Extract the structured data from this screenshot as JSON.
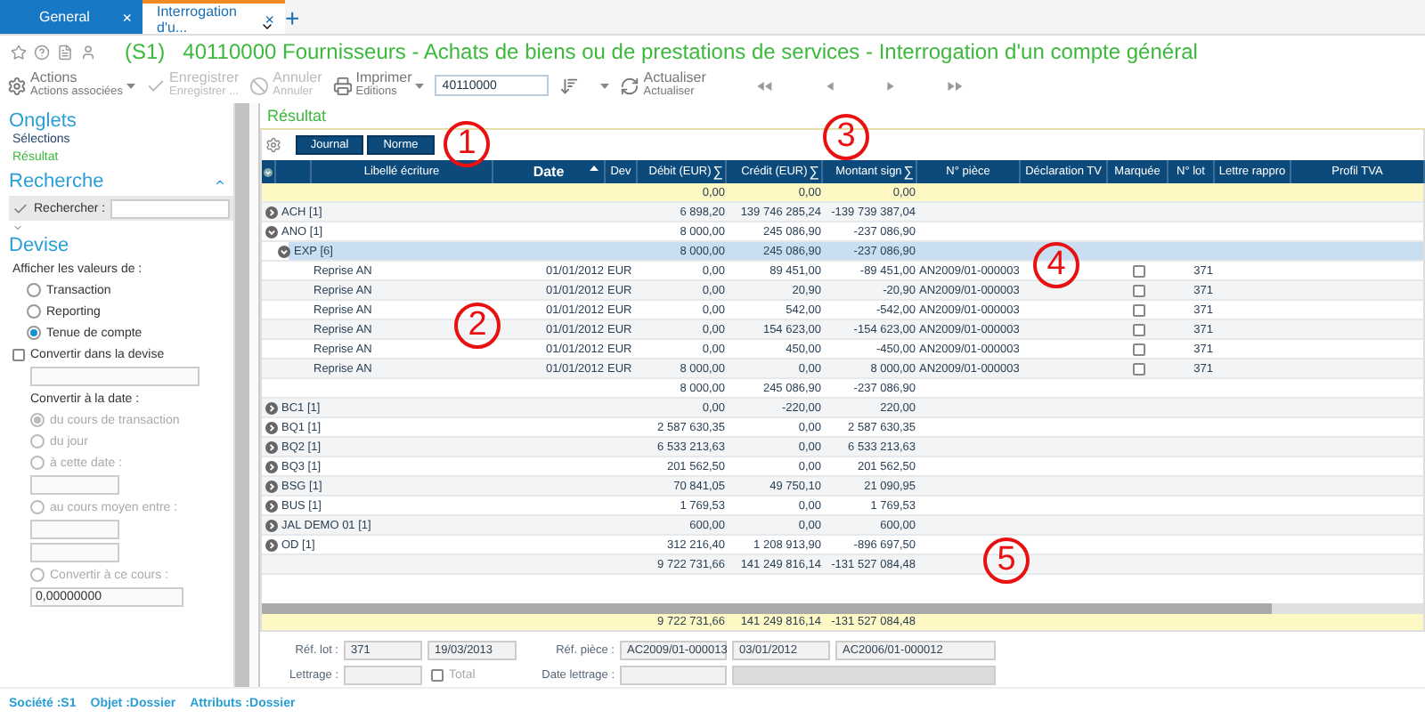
{
  "tabs": [
    {
      "label": "General",
      "selected": false,
      "close": "×"
    },
    {
      "label": "Interrogation d'u...",
      "selected": true,
      "close": "×"
    }
  ],
  "new_tab": "+",
  "title": {
    "code": "(S1)",
    "text": "40110000 Fournisseurs - Achats de biens ou de prestations de services - Interrogation d'un compte général"
  },
  "toolbar": {
    "buttons": [
      {
        "kind": "gear",
        "label": "Actions",
        "sublabel": "Actions associées",
        "disabled": false,
        "dropdown": true
      },
      {
        "kind": "check",
        "label": "Enregistrer",
        "sublabel": "Enregistrer ...",
        "disabled": true,
        "dropdown": false
      },
      {
        "kind": "cancel",
        "label": "Annuler",
        "sublabel": "Annuler",
        "disabled": true,
        "dropdown": false
      },
      {
        "kind": "print",
        "label": "Imprimer",
        "sublabel": "Editions",
        "disabled": false,
        "dropdown": true
      }
    ],
    "account": "40110000",
    "refresh": {
      "label": "Actualiser",
      "sublabel": "Actualiser"
    }
  },
  "sidebar": {
    "tabs_title": "Onglets",
    "sections": [
      {
        "label": "Sélections",
        "selected": false
      },
      {
        "label": "Résultat",
        "selected": true
      }
    ],
    "search_title": "Recherche",
    "search_label": "Rechercher :",
    "currency": {
      "title": "Devise",
      "show_label": "Afficher les valeurs de :",
      "show_options": [
        {
          "label": "Transaction",
          "selected": false
        },
        {
          "label": "Reporting",
          "selected": false
        },
        {
          "label": "Tenue de compte",
          "selected": true
        }
      ],
      "convert": {
        "label": "Convertir dans la devise",
        "checked": false
      },
      "date_label": "Convertir à la date :",
      "disabled": true,
      "date_items": [
        {
          "kind": "radio",
          "label": "du cours de transaction",
          "selected": true
        },
        {
          "kind": "radio",
          "label": "du jour",
          "selected": false
        },
        {
          "kind": "radio",
          "label": "à cette date :",
          "selected": false
        },
        {
          "kind": "input"
        },
        {
          "kind": "radio",
          "label": "au cours moyen entre :",
          "selected": false
        },
        {
          "kind": "input"
        },
        {
          "kind": "input"
        },
        {
          "kind": "radio",
          "label": "Convertir à ce cours :",
          "selected": false
        },
        {
          "kind": "input",
          "value": "0,00000000"
        }
      ]
    }
  },
  "result_title": "Résultat",
  "view_buttons": [
    "Journal",
    "Norme"
  ],
  "table": {
    "columns": [
      {
        "sorted": false
      },
      {
        "sorted": false
      },
      {
        "label": "Libellé écriture",
        "sorted": false
      },
      {
        "label": "Date",
        "sorted": true
      },
      {
        "label": "Dev",
        "sorted": false
      },
      {
        "label": "Débit (EUR)",
        "sum_sign": "∑",
        "sorted": false
      },
      {
        "label": "Crédit (EUR)",
        "sum_sign": "∑",
        "sorted": false
      },
      {
        "label": "Montant sign",
        "sum_sign": "∑",
        "sorted": false
      },
      {
        "label": "N° pièce",
        "sorted": false
      },
      {
        "label": "Déclaration TV",
        "sorted": false
      },
      {
        "label": "Marquée",
        "sorted": false
      },
      {
        "label": "N° lot",
        "sorted": false
      },
      {
        "label": "Lettre rappro",
        "sorted": false
      },
      {
        "label": "Profil TVA",
        "sorted": false
      }
    ],
    "rows": [
      {
        "kind": "summary",
        "debit": "0,00",
        "credit": "0,00",
        "signed": "0,00"
      },
      {
        "kind": "group",
        "label": "ACH [1]",
        "debit": "6 898,20",
        "credit": "139 746 285,24",
        "signed": "-139 739 387,04",
        "expanded": false,
        "selected": false
      },
      {
        "kind": "group",
        "label": "ANO [1]",
        "debit": "8 000,00",
        "credit": "245 086,90",
        "signed": "-237 086,90",
        "expanded": true,
        "selected": false,
        "children": [
          {
            "kind": "group",
            "label": "EXP [6]",
            "debit": "8 000,00",
            "credit": "245 086,90",
            "signed": "-237 086,90",
            "expanded": true,
            "selected": true,
            "children": [
              {
                "kind": "entry",
                "libelle": "Reprise AN",
                "date": "01/01/2012",
                "dev": "EUR",
                "debit": "0,00",
                "credit": "89 451,00",
                "signed": "-89 451,00",
                "piece": "AN2009/01-000003",
                "marked": false,
                "lot": "371"
              },
              {
                "kind": "entry",
                "libelle": "Reprise AN",
                "date": "01/01/2012",
                "dev": "EUR",
                "debit": "0,00",
                "credit": "20,90",
                "signed": "-20,90",
                "piece": "AN2009/01-000003",
                "marked": false,
                "lot": "371"
              },
              {
                "kind": "entry",
                "libelle": "Reprise AN",
                "date": "01/01/2012",
                "dev": "EUR",
                "debit": "0,00",
                "credit": "542,00",
                "signed": "-542,00",
                "piece": "AN2009/01-000003",
                "marked": false,
                "lot": "371"
              },
              {
                "kind": "entry",
                "libelle": "Reprise AN",
                "date": "01/01/2012",
                "dev": "EUR",
                "debit": "0,00",
                "credit": "154 623,00",
                "signed": "-154 623,00",
                "piece": "AN2009/01-000003",
                "marked": false,
                "lot": "371"
              },
              {
                "kind": "entry",
                "libelle": "Reprise AN",
                "date": "01/01/2012",
                "dev": "EUR",
                "debit": "0,00",
                "credit": "450,00",
                "signed": "-450,00",
                "piece": "AN2009/01-000003",
                "marked": false,
                "lot": "371"
              },
              {
                "kind": "entry",
                "libelle": "Reprise AN",
                "date": "01/01/2012",
                "dev": "EUR",
                "debit": "8 000,00",
                "credit": "0,00",
                "signed": "8 000,00",
                "piece": "AN2009/01-000003",
                "marked": false,
                "lot": "371"
              },
              {
                "kind": "subtotal",
                "debit": "8 000,00",
                "credit": "245 086,90",
                "signed": "-237 086,90"
              }
            ]
          }
        ]
      },
      {
        "kind": "group",
        "label": "BC1 [1]",
        "debit": "0,00",
        "credit": "-220,00",
        "signed": "220,00",
        "expanded": false,
        "selected": false
      },
      {
        "kind": "group",
        "label": "BQ1 [1]",
        "debit": "2 587 630,35",
        "credit": "0,00",
        "signed": "2 587 630,35",
        "expanded": false,
        "selected": false
      },
      {
        "kind": "group",
        "label": "BQ2 [1]",
        "debit": "6 533 213,63",
        "credit": "0,00",
        "signed": "6 533 213,63",
        "expanded": false,
        "selected": false
      },
      {
        "kind": "group",
        "label": "BQ3 [1]",
        "debit": "201 562,50",
        "credit": "0,00",
        "signed": "201 562,50",
        "expanded": false,
        "selected": false
      },
      {
        "kind": "group",
        "label": "BSG [1]",
        "debit": "70 841,05",
        "credit": "49 750,10",
        "signed": "21 090,95",
        "expanded": false,
        "selected": false
      },
      {
        "kind": "group",
        "label": "BUS [1]",
        "debit": "1 769,53",
        "credit": "0,00",
        "signed": "1 769,53",
        "expanded": false,
        "selected": false
      },
      {
        "kind": "group",
        "label": "JAL DEMO 01 [1]",
        "debit": "600,00",
        "credit": "0,00",
        "signed": "600,00",
        "expanded": false,
        "selected": false
      },
      {
        "kind": "group",
        "label": "OD [1]",
        "debit": "312 216,40",
        "credit": "1 208 913,90",
        "signed": "-896 697,50",
        "expanded": false,
        "selected": false
      },
      {
        "kind": "subtotal",
        "debit": "9 722 731,66",
        "credit": "141 249 816,14",
        "signed": "-131 527 084,48"
      }
    ],
    "totals": {
      "debit": "9 722 731,66",
      "credit": "141 249 816,14",
      "signed": "-131 527 084,48"
    }
  },
  "form": {
    "ref_lot_label": "Réf. lot :",
    "ref_lot": "371",
    "ref_lot_date": "19/03/2013",
    "ref_piece_label": "Réf. pièce :",
    "ref_piece": "AC2009/01-000013",
    "ref_piece_date": "03/01/2012",
    "ref_piece_other": "AC2006/01-000012",
    "lettrage_label": "Lettrage :",
    "total": {
      "label": "Total",
      "checked": false
    },
    "date_lettrage_label": "Date lettrage :"
  },
  "status_bar": [
    "Société :S1",
    "Objet :Dossier",
    "Attributs :Dossier"
  ],
  "callouts": [
    "1",
    "2",
    "3",
    "4",
    "5"
  ]
}
